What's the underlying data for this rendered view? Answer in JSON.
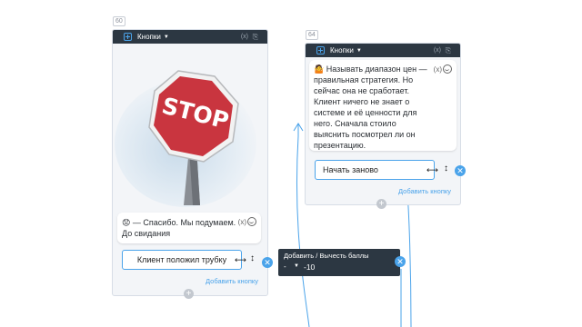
{
  "colors": {
    "header_bg": "#2c3742",
    "accent": "#4aa3ea",
    "card_bg": "#f3f5f8",
    "stop_red": "#c9353f"
  },
  "node_left": {
    "id": "60",
    "header": {
      "title": "Кнопки",
      "var_label": "(x)",
      "clip_icon": "paperclip-icon"
    },
    "image": {
      "sign_text": "STOP"
    },
    "message": {
      "emoji": "😟",
      "text": "— Спасибо. Мы подумаем. До свидания",
      "var_label": "(x)"
    },
    "button": {
      "label": "Клиент положил трубку"
    },
    "add_button_label": "Добавить кнопку"
  },
  "node_right": {
    "id": "64",
    "header": {
      "title": "Кнопки",
      "var_label": "(x)",
      "clip_icon": "paperclip-icon"
    },
    "message": {
      "emoji": "🤷",
      "text": "Называть диапазон цен — правильная стратегия. Но сейчас она не сработает. Клиент ничего не знает о системе и её ценности для него. Сначала стоило выяснить посмотрел ли он презентацию.",
      "var_label": "(x)"
    },
    "button": {
      "label": "Начать заново"
    },
    "add_button_label": "Добавить кнопку"
  },
  "score_panel": {
    "title": "Добавить / Вычесть баллы",
    "sign": "-",
    "value": "-10"
  }
}
